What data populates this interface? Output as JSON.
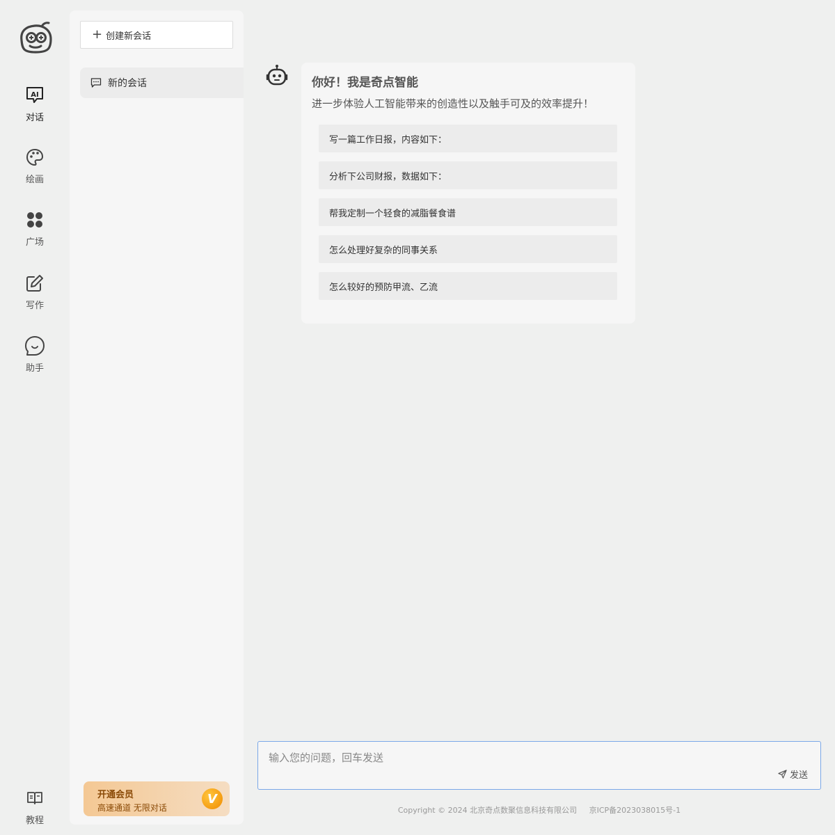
{
  "nav": {
    "items": [
      {
        "id": "chat",
        "label": "对话",
        "icon": "ai-chat-icon"
      },
      {
        "id": "draw",
        "label": "绘画",
        "icon": "palette-icon"
      },
      {
        "id": "square",
        "label": "广场",
        "icon": "grid-dots-icon"
      },
      {
        "id": "write",
        "label": "写作",
        "icon": "edit-icon"
      },
      {
        "id": "assistant",
        "label": "助手",
        "icon": "smile-bubble-icon"
      }
    ],
    "tutorial": {
      "label": "教程",
      "icon": "book-icon"
    }
  },
  "sidebar": {
    "new_chat_label": "创建新会话",
    "conversations": [
      {
        "title": "新的会话"
      }
    ],
    "vip": {
      "title": "开通会员",
      "subtitle": "高速通道 无限对话",
      "badge": "V"
    }
  },
  "welcome": {
    "title": "你好！我是奇点智能",
    "subtitle": "进一步体验人工智能带来的创造性以及触手可及的效率提升！",
    "suggestions": [
      "写一篇工作日报，内容如下：",
      "分析下公司财报，数据如下：",
      "帮我定制一个轻食的减脂餐食谱",
      "怎么处理好复杂的同事关系",
      "怎么较好的预防甲流、乙流"
    ]
  },
  "input": {
    "placeholder": "输入您的问题，回车发送",
    "value": "",
    "send_label": "发送"
  },
  "footer": {
    "copyright": "Copyright © 2024 北京奇点数聚信息科技有限公司",
    "icp": "京ICP备2023038015号-1"
  },
  "colors": {
    "background": "#eff0ef",
    "panel": "#f6f6f6",
    "input_border": "#7aa8e8",
    "vip_gold": "#f08b00"
  }
}
